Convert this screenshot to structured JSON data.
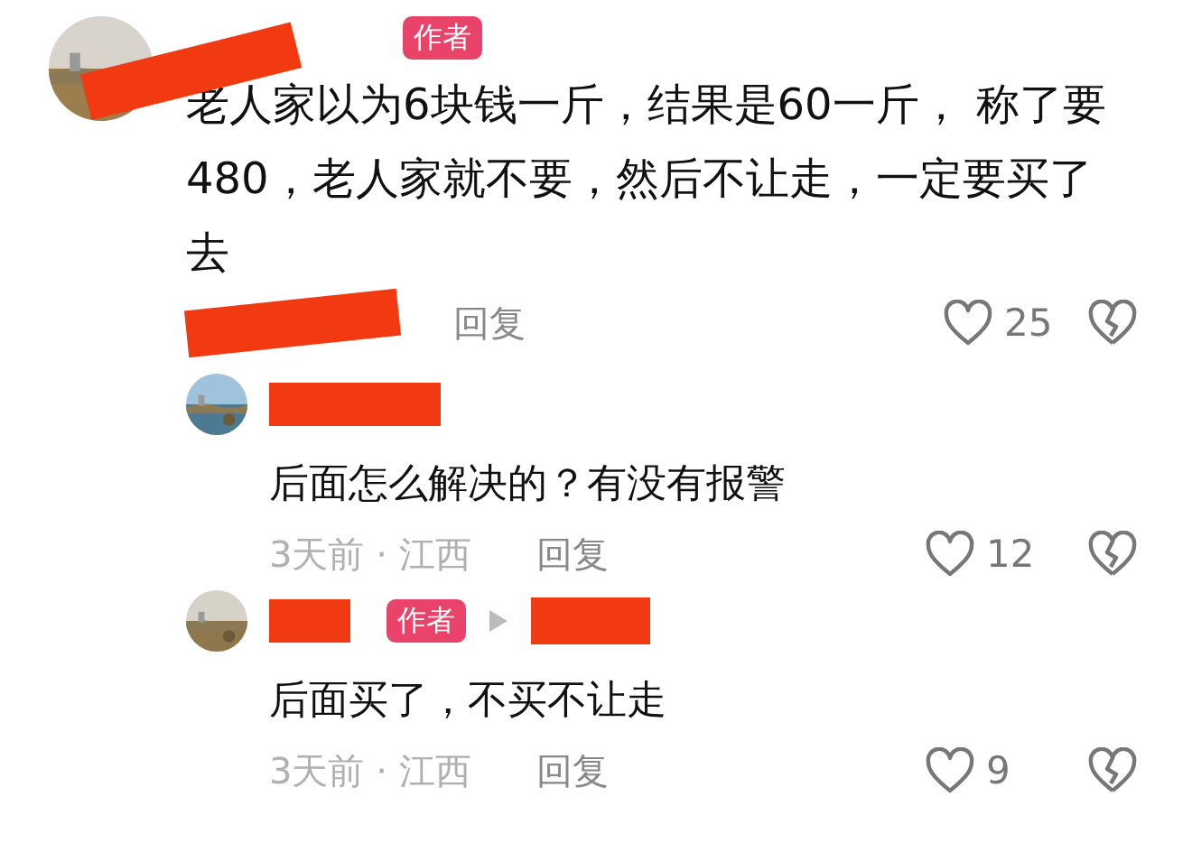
{
  "comments": [
    {
      "kind": "top",
      "badge": "作者",
      "reply_arrow": false,
      "text": "老人家以为6块钱一斤，结果是60一斤， 称了要480，老人家就不要，然后不让走，一定要买了去",
      "reply": "回复",
      "likes": "25"
    },
    {
      "kind": "reply",
      "reply_arrow": false,
      "text": "后面怎么解决的？有没有报警",
      "time": "3天前 · 江西",
      "reply": "回复",
      "likes": "12"
    },
    {
      "kind": "reply",
      "badge": "作者",
      "reply_arrow": true,
      "text": "后面买了，不买不让走",
      "time": "3天前 · 江西",
      "reply": "回复",
      "likes": "9"
    }
  ]
}
